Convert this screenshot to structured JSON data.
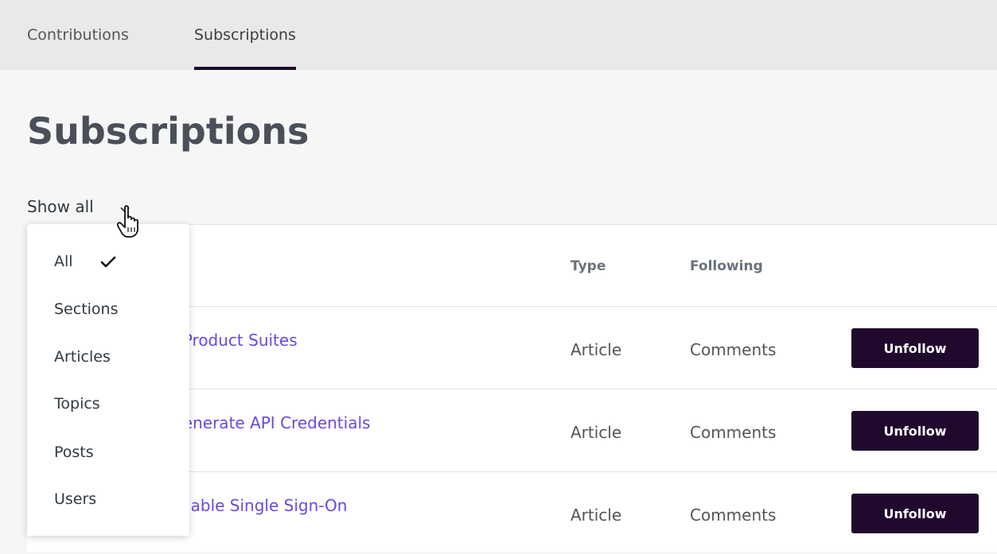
{
  "tabs": [
    {
      "label": "Contributions",
      "active": false
    },
    {
      "label": "Subscriptions",
      "active": true
    }
  ],
  "page_title": "Subscriptions",
  "filter": {
    "label": "Show all"
  },
  "dropdown": {
    "items": [
      "All",
      "Sections",
      "Articles",
      "Topics",
      "Posts",
      "Users"
    ],
    "selected": "All"
  },
  "table": {
    "headers": {
      "type": "Type",
      "following": "Following"
    },
    "rows": [
      {
        "title": "tform Product Suites",
        "type": "Article",
        "following": "Comments",
        "action": "Unfollow"
      },
      {
        "title": "ng - Generate API Credentials",
        "type": "Article",
        "following": "Comments",
        "action": "Unfollow"
      },
      {
        "title": "ng - Enable Single Sign-On",
        "type": "Article",
        "following": "Comments",
        "action": "Unfollow"
      }
    ]
  },
  "colors": {
    "accent": "#1f0a2e",
    "link": "#6b47e0",
    "tabbar_bg": "#e9e9e9"
  },
  "icons": {
    "filter_caret": "chevron-down-icon",
    "selected_check": "checkmark-icon",
    "mouse_pointer": "hand-pointer-icon"
  }
}
